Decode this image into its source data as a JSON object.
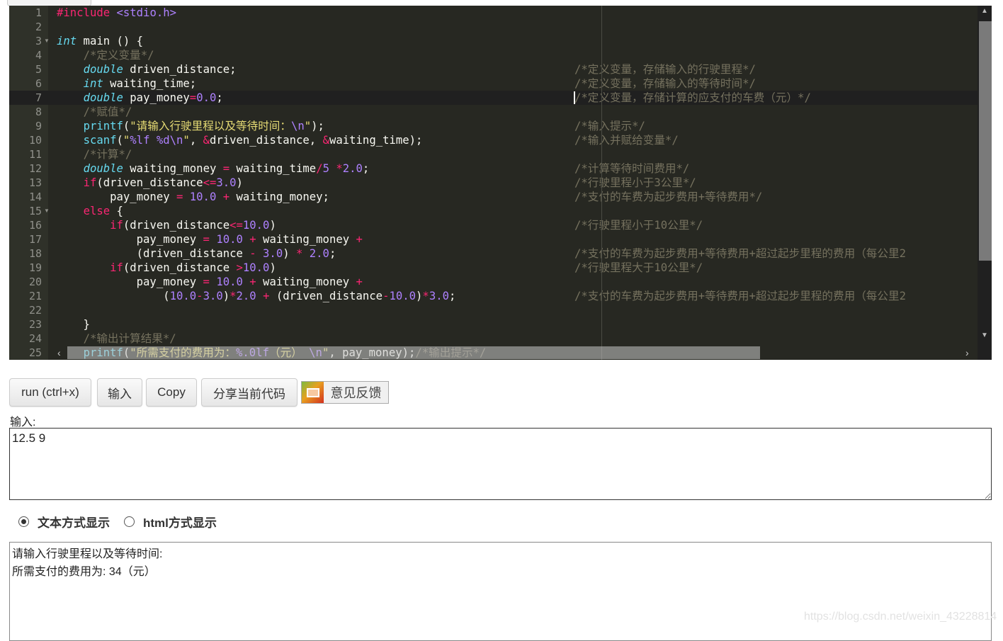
{
  "editor": {
    "active_line": 7,
    "fold_lines": [
      3,
      15
    ],
    "lines": [
      {
        "n": "1",
        "tokens": [
          [
            "k",
            "#include"
          ],
          [
            "t",
            " "
          ],
          [
            "n",
            "<stdio.h>"
          ]
        ]
      },
      {
        "n": "2",
        "tokens": []
      },
      {
        "n": "3",
        "tokens": [
          [
            "y",
            "int"
          ],
          [
            "t",
            " main () {"
          ]
        ]
      },
      {
        "n": "4",
        "tokens": [
          [
            "t",
            "    "
          ],
          [
            "c",
            "/*定义变量*/"
          ]
        ]
      },
      {
        "n": "5",
        "tokens": [
          [
            "t",
            "    "
          ],
          [
            "y",
            "double"
          ],
          [
            "t",
            " driven_distance;"
          ]
        ],
        "side": "/*定义变量，存储输入的行驶里程*/"
      },
      {
        "n": "6",
        "tokens": [
          [
            "t",
            "    "
          ],
          [
            "y",
            "int"
          ],
          [
            "t",
            " waiting_time;"
          ]
        ],
        "side": "/*定义变量，存储输入的等待时间*/"
      },
      {
        "n": "7",
        "tokens": [
          [
            "t",
            "    "
          ],
          [
            "y",
            "double"
          ],
          [
            "t",
            " pay_money"
          ],
          [
            "k",
            "="
          ],
          [
            "n",
            "0.0"
          ],
          [
            "t",
            ";"
          ]
        ],
        "side": "/*定义变量，存储计算的应支付的车费（元）*/"
      },
      {
        "n": "8",
        "tokens": [
          [
            "t",
            "    "
          ],
          [
            "c",
            "/*赋值*/"
          ]
        ]
      },
      {
        "n": "9",
        "tokens": [
          [
            "t",
            "    "
          ],
          [
            "f",
            "printf"
          ],
          [
            "t",
            "("
          ],
          [
            "s",
            "\"请输入行驶里程以及等待时间："
          ],
          [
            "n",
            "\\n"
          ],
          [
            "s",
            "\""
          ],
          [
            "t",
            ");"
          ]
        ],
        "side": "/*输入提示*/"
      },
      {
        "n": "10",
        "tokens": [
          [
            "t",
            "    "
          ],
          [
            "f",
            "scanf"
          ],
          [
            "t",
            "("
          ],
          [
            "s",
            "\""
          ],
          [
            "n",
            "%lf"
          ],
          [
            "s",
            " "
          ],
          [
            "n",
            "%d\\n"
          ],
          [
            "s",
            "\""
          ],
          [
            "t",
            ", "
          ],
          [
            "k",
            "&"
          ],
          [
            "t",
            "driven_distance, "
          ],
          [
            "k",
            "&"
          ],
          [
            "t",
            "waiting_time);"
          ]
        ],
        "side": "/*输入并赋给变量*/"
      },
      {
        "n": "11",
        "tokens": [
          [
            "t",
            "    "
          ],
          [
            "c",
            "/*计算*/"
          ]
        ]
      },
      {
        "n": "12",
        "tokens": [
          [
            "t",
            "    "
          ],
          [
            "y",
            "double"
          ],
          [
            "t",
            " waiting_money "
          ],
          [
            "k",
            "="
          ],
          [
            "t",
            " waiting_time"
          ],
          [
            "k",
            "/"
          ],
          [
            "n",
            "5"
          ],
          [
            "t",
            " "
          ],
          [
            "k",
            "*"
          ],
          [
            "n",
            "2.0"
          ],
          [
            "t",
            ";"
          ]
        ],
        "side": "/*计算等待时间费用*/"
      },
      {
        "n": "13",
        "tokens": [
          [
            "t",
            "    "
          ],
          [
            "k",
            "if"
          ],
          [
            "t",
            "(driven_distance"
          ],
          [
            "k",
            "<="
          ],
          [
            "n",
            "3.0"
          ],
          [
            "t",
            ")"
          ]
        ],
        "side": "/*行驶里程小于3公里*/"
      },
      {
        "n": "14",
        "tokens": [
          [
            "t",
            "        pay_money "
          ],
          [
            "k",
            "="
          ],
          [
            "t",
            " "
          ],
          [
            "n",
            "10.0"
          ],
          [
            "t",
            " "
          ],
          [
            "k",
            "+"
          ],
          [
            "t",
            " waiting_money;"
          ]
        ],
        "side": "/*支付的车费为起步费用+等待费用*/"
      },
      {
        "n": "15",
        "tokens": [
          [
            "t",
            "    "
          ],
          [
            "k",
            "else"
          ],
          [
            "t",
            " {"
          ]
        ]
      },
      {
        "n": "16",
        "tokens": [
          [
            "t",
            "        "
          ],
          [
            "k",
            "if"
          ],
          [
            "t",
            "(driven_distance"
          ],
          [
            "k",
            "<="
          ],
          [
            "n",
            "10.0"
          ],
          [
            "t",
            ")"
          ]
        ],
        "side": "/*行驶里程小于10公里*/"
      },
      {
        "n": "17",
        "tokens": [
          [
            "t",
            "            pay_money "
          ],
          [
            "k",
            "="
          ],
          [
            "t",
            " "
          ],
          [
            "n",
            "10.0"
          ],
          [
            "t",
            " "
          ],
          [
            "k",
            "+"
          ],
          [
            "t",
            " waiting_money "
          ],
          [
            "k",
            "+"
          ]
        ]
      },
      {
        "n": "18",
        "tokens": [
          [
            "t",
            "            (driven_distance "
          ],
          [
            "k",
            "-"
          ],
          [
            "t",
            " "
          ],
          [
            "n",
            "3.0"
          ],
          [
            "t",
            ") "
          ],
          [
            "k",
            "*"
          ],
          [
            "t",
            " "
          ],
          [
            "n",
            "2.0"
          ],
          [
            "t",
            ";"
          ]
        ],
        "side": "/*支付的车费为起步费用+等待费用+超过起步里程的费用（每公里2"
      },
      {
        "n": "19",
        "tokens": [
          [
            "t",
            "        "
          ],
          [
            "k",
            "if"
          ],
          [
            "t",
            "(driven_distance "
          ],
          [
            "k",
            ">"
          ],
          [
            "n",
            "10.0"
          ],
          [
            "t",
            ")"
          ]
        ],
        "side": "/*行驶里程大于10公里*/"
      },
      {
        "n": "20",
        "tokens": [
          [
            "t",
            "            pay_money "
          ],
          [
            "k",
            "="
          ],
          [
            "t",
            " "
          ],
          [
            "n",
            "10.0"
          ],
          [
            "t",
            " "
          ],
          [
            "k",
            "+"
          ],
          [
            "t",
            " waiting_money "
          ],
          [
            "k",
            "+"
          ]
        ]
      },
      {
        "n": "21",
        "tokens": [
          [
            "t",
            "                ("
          ],
          [
            "n",
            "10.0"
          ],
          [
            "k",
            "-"
          ],
          [
            "n",
            "3.0"
          ],
          [
            "t",
            ")"
          ],
          [
            "k",
            "*"
          ],
          [
            "n",
            "2.0"
          ],
          [
            "t",
            " "
          ],
          [
            "k",
            "+"
          ],
          [
            "t",
            " (driven_distance"
          ],
          [
            "k",
            "-"
          ],
          [
            "n",
            "10.0"
          ],
          [
            "t",
            ")"
          ],
          [
            "k",
            "*"
          ],
          [
            "n",
            "3.0"
          ],
          [
            "t",
            ";"
          ]
        ],
        "side": "/*支付的车费为起步费用+等待费用+超过起步里程的费用（每公里2"
      },
      {
        "n": "22",
        "tokens": []
      },
      {
        "n": "23",
        "tokens": [
          [
            "t",
            "    }"
          ]
        ]
      },
      {
        "n": "24",
        "tokens": [
          [
            "t",
            "    "
          ],
          [
            "c",
            "/*输出计算结果*/"
          ]
        ]
      },
      {
        "n": "25",
        "tokens": [
          [
            "t",
            "    "
          ],
          [
            "f",
            "printf"
          ],
          [
            "t",
            "("
          ],
          [
            "s",
            "\"所需支付的费用为："
          ],
          [
            "n",
            "%.0lf"
          ],
          [
            "s",
            "（元） "
          ],
          [
            "n",
            "\\n"
          ],
          [
            "s",
            "\""
          ],
          [
            "t",
            ", pay_money);"
          ],
          [
            "c",
            "/*输出提示*/"
          ]
        ]
      }
    ]
  },
  "toolbar": {
    "run_label": "run (ctrl+x)",
    "input_label": "输入",
    "copy_label": "Copy",
    "share_label": "分享当前代码",
    "feedback_label": "意见反馈"
  },
  "input": {
    "label": "输入:",
    "value": "12.5 9"
  },
  "display_mode": {
    "options": [
      {
        "label": "文本方式显示",
        "selected": true
      },
      {
        "label": "html方式显示",
        "selected": false
      }
    ]
  },
  "output": {
    "lines": [
      "请输入行驶里程以及等待时间:",
      "所需支付的费用为: 34（元）"
    ]
  },
  "watermark": "https://blog.csdn.net/weixin_43228814",
  "colors": {
    "editor_bg": "#272822",
    "keyword": "#f92672",
    "type": "#66d9ef",
    "number": "#ae81ff",
    "string": "#e6db74",
    "comment": "#75715e"
  }
}
